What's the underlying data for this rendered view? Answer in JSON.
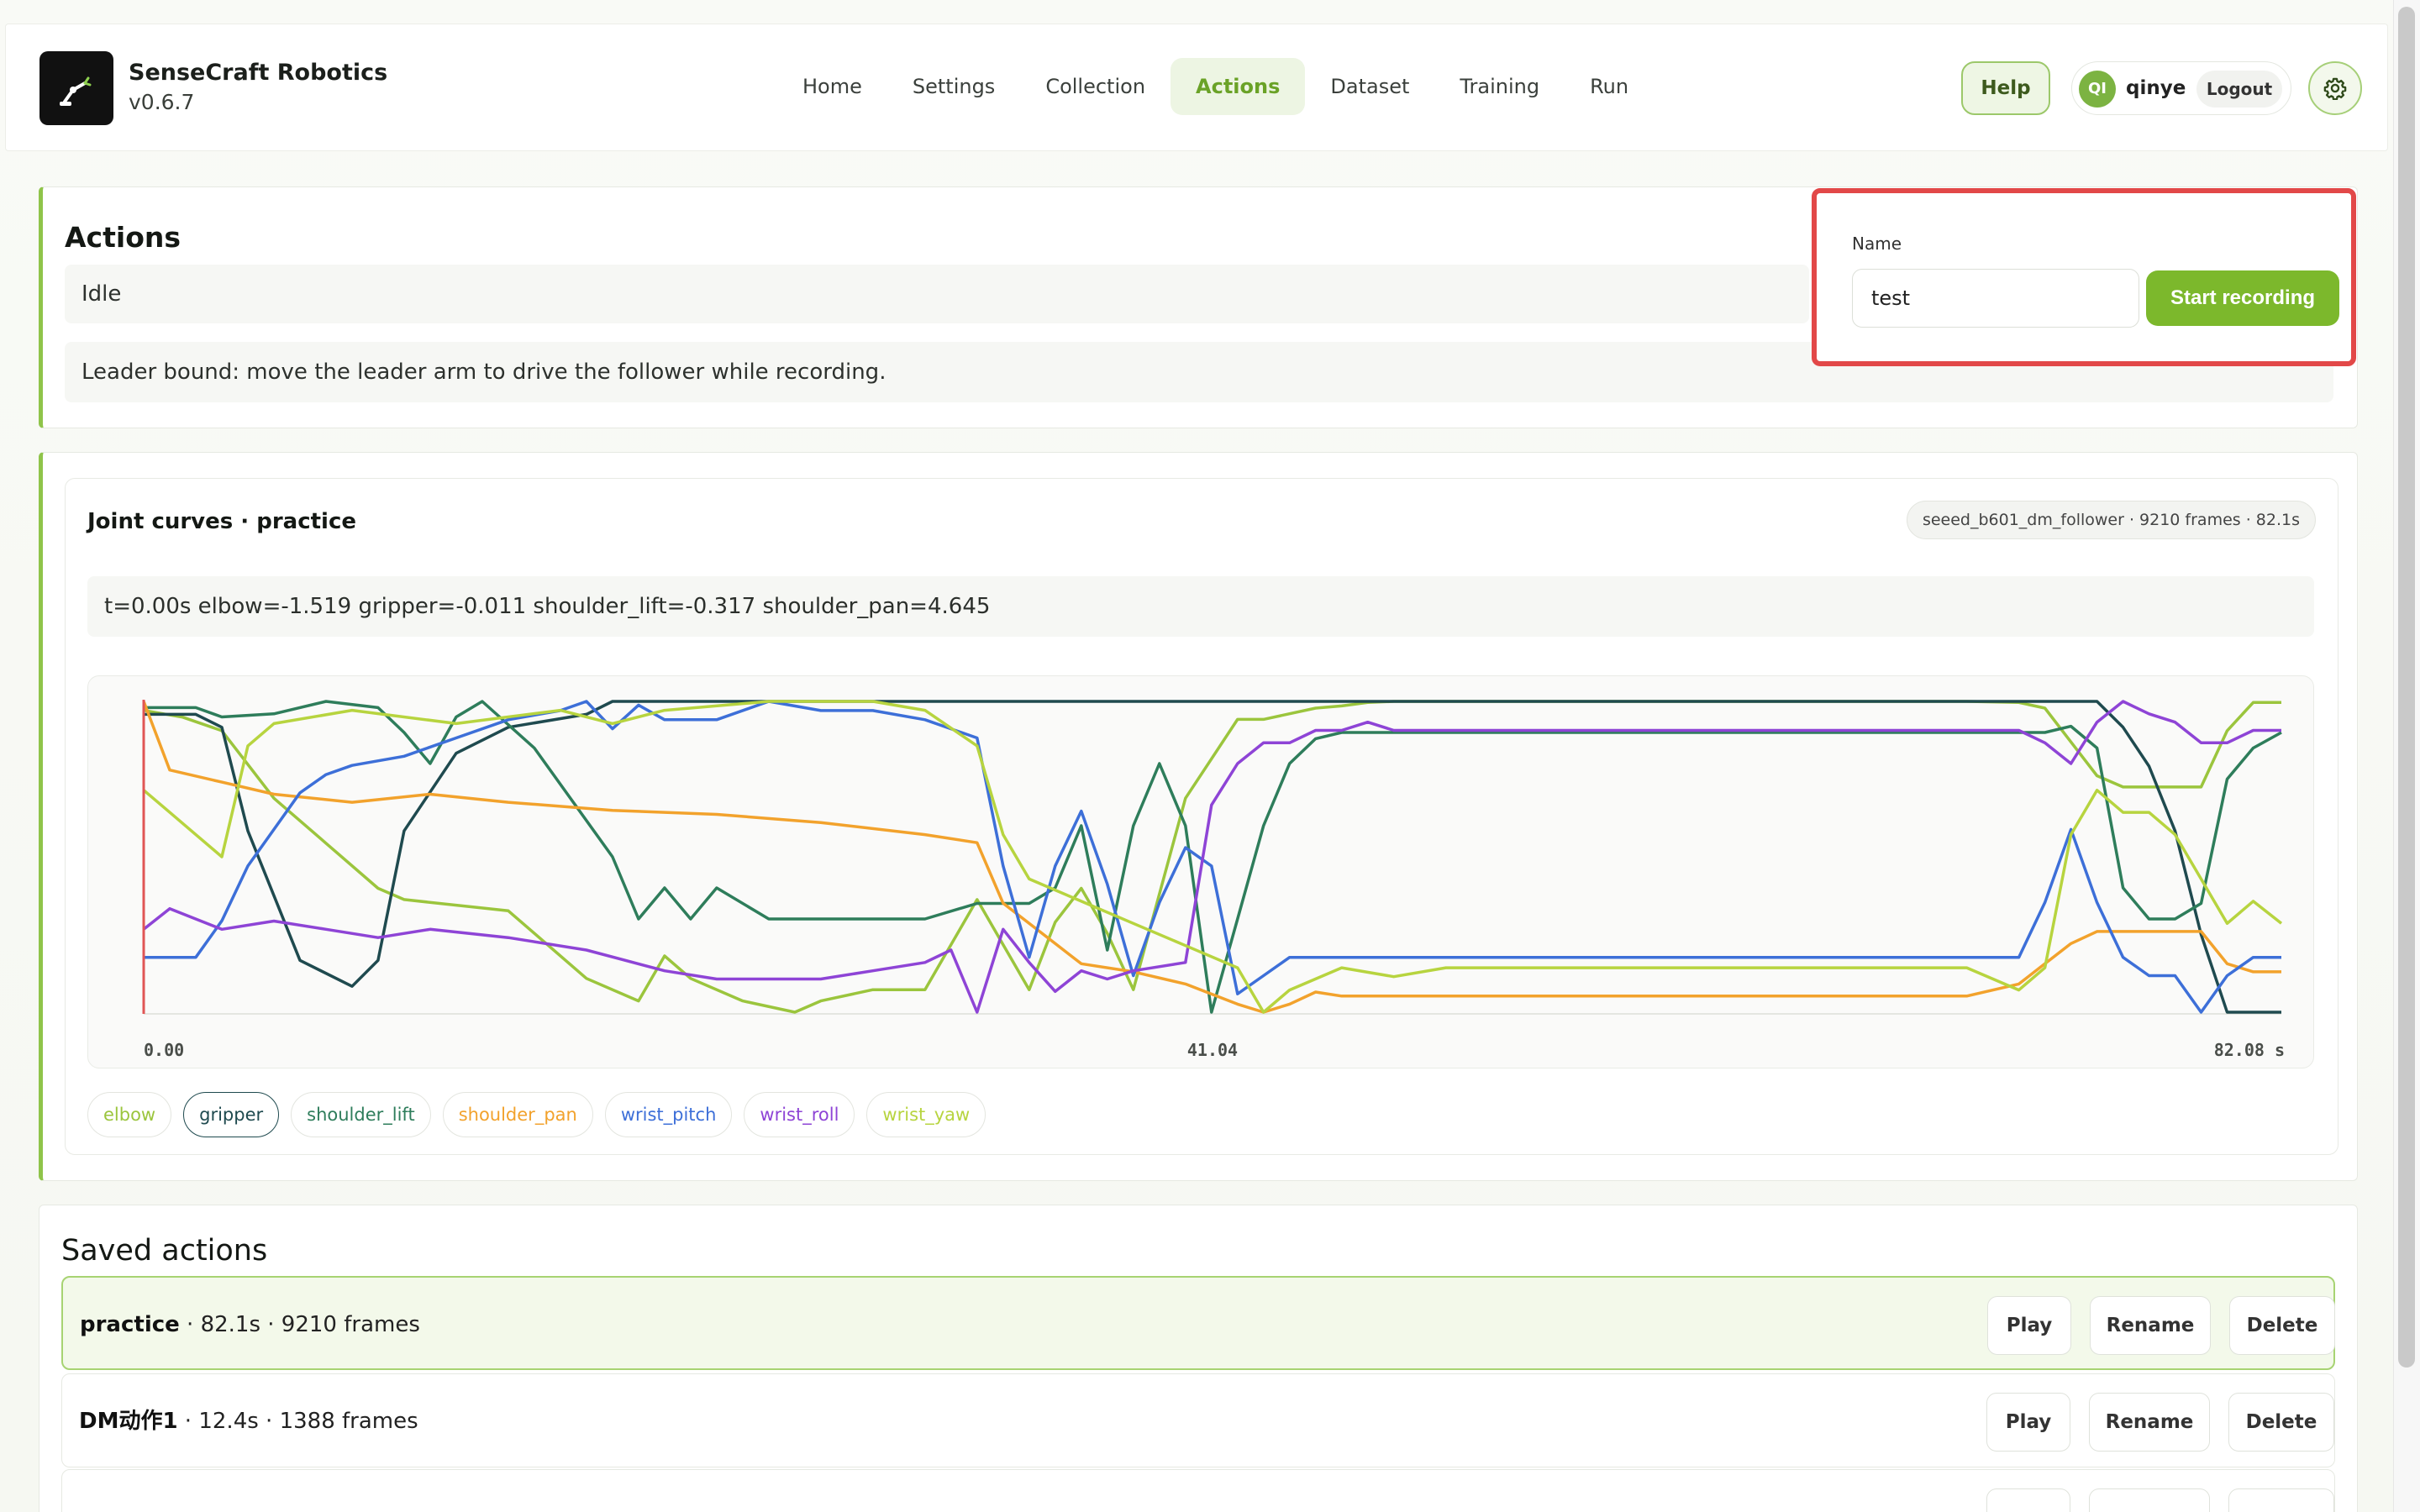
{
  "header": {
    "brand_name": "SenseCraft Robotics",
    "version": "v0.6.7",
    "nav": [
      "Home",
      "Settings",
      "Collection",
      "Actions",
      "Dataset",
      "Training",
      "Run"
    ],
    "active_nav": "Actions",
    "help_label": "Help",
    "avatar_initials": "QI",
    "username": "qinye",
    "logout_label": "Logout",
    "settings_icon": "gear-icon"
  },
  "actions_panel": {
    "title": "Actions",
    "status": "Idle",
    "hint": "Leader bound: move the leader arm to drive the follower while recording.",
    "name_label": "Name",
    "name_value": "test",
    "start_label": "Start recording"
  },
  "curves_panel": {
    "title": "Joint curves · practice",
    "badge": "seeed_b601_dm_follower · 9210 frames · 82.1s",
    "readout": "t=0.00s elbow=-1.519 gripper=-0.011 shoulder_lift=-0.317 shoulder_pan=4.645"
  },
  "chart_data": {
    "type": "line",
    "x_ticks": [
      "0.00",
      "41.04",
      "82.08 s"
    ],
    "xlim": [
      0,
      82.08
    ],
    "cursor_t": 0.0,
    "series": [
      {
        "name": "elbow",
        "color": "#9bc53d",
        "x": [
          0,
          1.5,
          3,
          5,
          7,
          9,
          10,
          14,
          17,
          19,
          20,
          21,
          23,
          25,
          26,
          28,
          30,
          31,
          32,
          33,
          34,
          35,
          36,
          37,
          38,
          40,
          42,
          43,
          44,
          45,
          46,
          47,
          48,
          49,
          50,
          52,
          58,
          64,
          70,
          72,
          73,
          74,
          75,
          76,
          77,
          78,
          79,
          80,
          81,
          82.08
        ],
        "y": [
          -1.52,
          -1.58,
          -1.7,
          -2.3,
          -2.7,
          -3.1,
          -3.2,
          -3.3,
          -3.9,
          -4.1,
          -3.7,
          -3.9,
          -4.1,
          -4.2,
          -4.1,
          -4.0,
          -4.0,
          -3.6,
          -3.2,
          -3.6,
          -4.0,
          -3.4,
          -3.1,
          -3.5,
          -4.0,
          -2.3,
          -1.6,
          -1.6,
          -1.55,
          -1.5,
          -1.48,
          -1.45,
          -1.44,
          -1.44,
          -1.44,
          -1.44,
          -1.44,
          -1.44,
          -1.44,
          -1.45,
          -1.5,
          -1.8,
          -2.1,
          -2.2,
          -2.2,
          -2.2,
          -2.2,
          -1.7,
          -1.45,
          -1.45
        ]
      },
      {
        "name": "gripper",
        "color": "#1f4a4f",
        "x": [
          0,
          2,
          3,
          4,
          6,
          8,
          9,
          10,
          12,
          14,
          17,
          18,
          20,
          24,
          28,
          32,
          36,
          40,
          44,
          46,
          48,
          52,
          58,
          64,
          70,
          72,
          73,
          74,
          75,
          76,
          77,
          78,
          79,
          80,
          81,
          82.08
        ],
        "y": [
          -0.01,
          -0.01,
          -0.02,
          -0.1,
          -0.2,
          -0.22,
          -0.2,
          -0.1,
          -0.04,
          -0.02,
          -0.01,
          0.0,
          0.0,
          0.0,
          0.0,
          0.0,
          0.0,
          0.0,
          0.0,
          0.0,
          0.0,
          0.0,
          0.0,
          0.0,
          0.0,
          0.0,
          0.0,
          0.0,
          0.0,
          -0.02,
          -0.05,
          -0.1,
          -0.18,
          -0.24,
          -0.24,
          -0.24
        ]
      },
      {
        "name": "shoulder_lift",
        "color": "#2e7d5b",
        "x": [
          0,
          2,
          3,
          5,
          7,
          9,
          10,
          11,
          12,
          13,
          15,
          18,
          19,
          20,
          21,
          22,
          24,
          26,
          28,
          30,
          32,
          34,
          35,
          36,
          37,
          38,
          39,
          40,
          41,
          42,
          43,
          44,
          45,
          46,
          47,
          48,
          50,
          52,
          58,
          64,
          70,
          72,
          73,
          74,
          75,
          76,
          77,
          78,
          79,
          80,
          81,
          82.08
        ],
        "y": [
          -0.32,
          -0.32,
          -0.35,
          -0.34,
          -0.3,
          -0.32,
          -0.4,
          -0.5,
          -0.35,
          -0.3,
          -0.45,
          -0.8,
          -1.0,
          -0.9,
          -1.0,
          -0.9,
          -1.0,
          -1.0,
          -1.0,
          -1.0,
          -0.95,
          -0.95,
          -0.9,
          -0.7,
          -1.1,
          -0.7,
          -0.5,
          -0.7,
          -1.3,
          -1.0,
          -0.7,
          -0.5,
          -0.42,
          -0.4,
          -0.4,
          -0.4,
          -0.4,
          -0.4,
          -0.4,
          -0.4,
          -0.4,
          -0.4,
          -0.4,
          -0.38,
          -0.45,
          -0.9,
          -1.0,
          -1.0,
          -0.95,
          -0.55,
          -0.45,
          -0.4
        ]
      },
      {
        "name": "shoulder_pan",
        "color": "#f2a22c",
        "x": [
          0,
          1,
          3,
          5,
          8,
          11,
          14,
          18,
          22,
          26,
          30,
          32,
          33,
          34,
          35,
          36,
          38,
          40,
          42,
          43,
          44,
          45,
          46,
          48,
          50,
          52,
          58,
          64,
          70,
          72,
          73,
          74,
          75,
          76,
          77,
          78,
          79,
          80,
          81,
          82.08
        ],
        "y": [
          4.65,
          4.48,
          4.45,
          4.42,
          4.4,
          4.42,
          4.4,
          4.38,
          4.37,
          4.35,
          4.32,
          4.3,
          4.15,
          4.1,
          4.05,
          4.0,
          3.98,
          3.95,
          3.9,
          3.88,
          3.9,
          3.93,
          3.92,
          3.92,
          3.92,
          3.92,
          3.92,
          3.92,
          3.92,
          3.95,
          4.0,
          4.05,
          4.08,
          4.08,
          4.08,
          4.08,
          4.08,
          4.0,
          3.98,
          3.98
        ]
      },
      {
        "name": "wrist_pitch",
        "color": "#3d6fd8",
        "x": [
          0,
          2,
          3,
          4,
          5,
          6,
          7,
          8,
          10,
          12,
          14,
          16,
          17,
          18,
          19,
          20,
          22,
          24,
          26,
          28,
          30,
          32,
          33,
          34,
          35,
          36,
          37,
          38,
          39,
          40,
          41,
          42,
          43,
          44,
          45,
          46,
          48,
          52,
          58,
          64,
          70,
          72,
          73,
          74,
          75,
          76,
          77,
          78,
          79,
          80,
          81,
          82.08
        ],
        "y": [
          0.0,
          0.0,
          0.2,
          0.5,
          0.7,
          0.9,
          1.0,
          1.05,
          1.1,
          1.2,
          1.3,
          1.35,
          1.4,
          1.25,
          1.38,
          1.3,
          1.3,
          1.4,
          1.35,
          1.35,
          1.3,
          1.2,
          0.5,
          0.0,
          0.5,
          0.8,
          0.4,
          -0.1,
          0.3,
          0.6,
          0.5,
          -0.2,
          -0.1,
          0.0,
          0.0,
          0.0,
          0.0,
          0.0,
          0.0,
          0.0,
          0.0,
          0.0,
          0.3,
          0.7,
          0.3,
          0.0,
          -0.1,
          -0.1,
          -0.3,
          -0.1,
          0.0,
          0.0
        ]
      },
      {
        "name": "wrist_roll",
        "color": "#8e44d6",
        "x": [
          0,
          1,
          3,
          5,
          7,
          9,
          11,
          14,
          17,
          20,
          22,
          24,
          26,
          28,
          30,
          31,
          32,
          33,
          34,
          35,
          36,
          37,
          38,
          40,
          41,
          42,
          43,
          44,
          45,
          46,
          47,
          48,
          50,
          52,
          58,
          64,
          70,
          72,
          73,
          74,
          75,
          76,
          77,
          78,
          79,
          80,
          81,
          82.08
        ],
        "y": [
          -1.3,
          -1.25,
          -1.3,
          -1.28,
          -1.3,
          -1.32,
          -1.3,
          -1.32,
          -1.35,
          -1.4,
          -1.42,
          -1.42,
          -1.42,
          -1.4,
          -1.38,
          -1.35,
          -1.5,
          -1.3,
          -1.38,
          -1.45,
          -1.4,
          -1.42,
          -1.4,
          -1.38,
          -1.0,
          -0.9,
          -0.85,
          -0.85,
          -0.82,
          -0.82,
          -0.8,
          -0.82,
          -0.82,
          -0.82,
          -0.82,
          -0.82,
          -0.82,
          -0.82,
          -0.85,
          -0.9,
          -0.8,
          -0.75,
          -0.78,
          -0.8,
          -0.85,
          -0.85,
          -0.82,
          -0.82
        ]
      },
      {
        "name": "wrist_yaw",
        "color": "#b7d43f",
        "x": [
          0,
          1,
          2,
          3,
          4,
          5,
          8,
          12,
          16,
          18,
          20,
          24,
          28,
          30,
          32,
          33,
          34,
          36,
          38,
          40,
          42,
          43,
          44,
          46,
          48,
          50,
          52,
          58,
          64,
          70,
          72,
          73,
          74,
          75,
          76,
          77,
          78,
          79,
          80,
          81,
          82.08
        ],
        "y": [
          0.1,
          0.05,
          0.0,
          -0.05,
          0.2,
          0.25,
          0.28,
          0.25,
          0.28,
          0.25,
          0.28,
          0.3,
          0.3,
          0.28,
          0.2,
          0.0,
          -0.1,
          -0.15,
          -0.2,
          -0.25,
          -0.3,
          -0.4,
          -0.35,
          -0.3,
          -0.32,
          -0.3,
          -0.3,
          -0.3,
          -0.3,
          -0.3,
          -0.35,
          -0.3,
          0.0,
          0.1,
          0.05,
          0.05,
          0.0,
          -0.1,
          -0.2,
          -0.15,
          -0.2
        ]
      }
    ]
  },
  "saved": {
    "title": "Saved actions",
    "rows": [
      {
        "name": "practice",
        "meta": " · 82.1s · 9210 frames",
        "selected": true
      },
      {
        "name": "DM动作1",
        "meta": " · 12.4s · 1388 frames",
        "selected": false
      }
    ],
    "play_label": "Play",
    "rename_label": "Rename",
    "delete_label": "Delete"
  }
}
